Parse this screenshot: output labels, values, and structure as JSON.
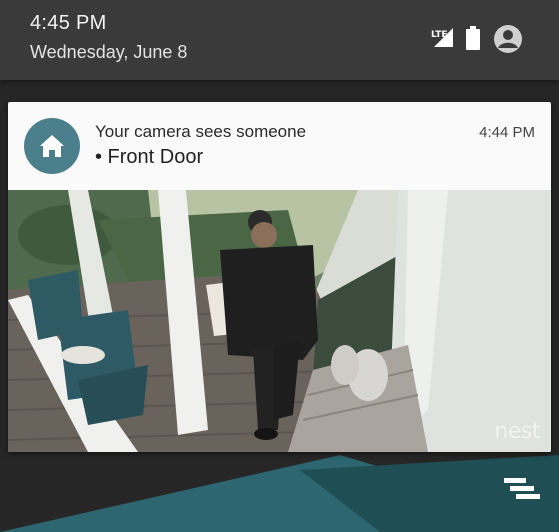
{
  "status_bar": {
    "time": "4:45 PM",
    "date": "Wednesday, June 8",
    "network": "LTE",
    "icons": [
      "signal-icon",
      "battery-icon",
      "account-icon"
    ]
  },
  "notification": {
    "app_icon": "home-icon",
    "title": "Your camera sees someone",
    "subtitle": "• Front Door",
    "time": "4:44 PM",
    "brand": "nest",
    "accent_color": "#4b7f8c"
  },
  "handle_icon": "stacked-bars-icon"
}
